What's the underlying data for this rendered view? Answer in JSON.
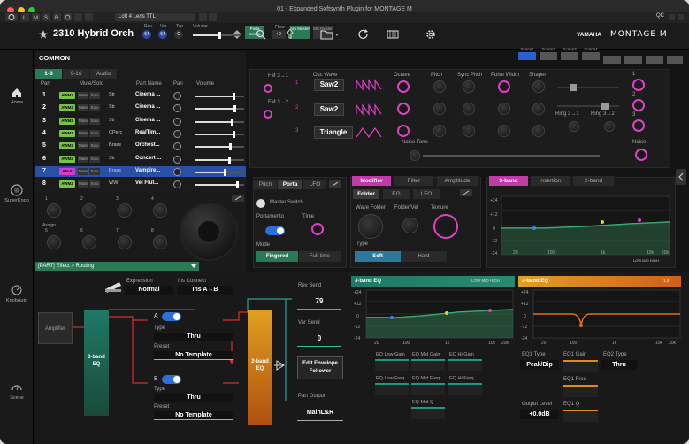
{
  "window": {
    "title": "01 - Expanded Softsynth Plugin for MONTAGE M"
  },
  "plugin_bar": {
    "preset": "Loft 4 Lens TTL",
    "qc": "QC"
  },
  "toolbar": {
    "perf_name": "2310 Hybrid Orch",
    "rev_label": "Rev",
    "rev_val": "64",
    "var_label": "Var",
    "var_val": "64",
    "tap_label": "Tap",
    "tap_val": "C",
    "volume_label": "Volume",
    "volume_level": 0.55,
    "portamento": "Porta mento",
    "flow_label": "Flow",
    "flow_val": "+0",
    "arp_master": "Arp Master",
    "ms_master": "MS Master",
    "brand": "YAMAHA",
    "model": "MONTAGE M"
  },
  "scenes": [
    "Scene1",
    "Scene2",
    "Scene3",
    "Scene4"
  ],
  "sidebar": [
    {
      "label": "Home",
      "icon": "home-icon"
    },
    {
      "label": "SuperKnob",
      "icon": "superknob-icon"
    },
    {
      "label": "KnobAuto",
      "icon": "knobauto-icon"
    },
    {
      "label": "Scene",
      "icon": "scene-icon"
    }
  ],
  "common": {
    "label": "COMMON",
    "tabs": [
      "1-8",
      "9-16",
      "Audio"
    ],
    "headers": {
      "part": "Part",
      "mute": "Mute/Solo",
      "partname": "Part Name",
      "pan": "Pan",
      "volume": "Volume"
    }
  },
  "parts": [
    {
      "num": "1",
      "type": "AWM2",
      "mute": "Mute",
      "solo": "Solo",
      "cat": "Str",
      "name": "Cinema ..."
    },
    {
      "num": "2",
      "type": "AWM2",
      "mute": "Mute",
      "solo": "Solo",
      "cat": "Str",
      "name": "Cinema ..."
    },
    {
      "num": "3",
      "type": "AWM2",
      "mute": "Mute",
      "solo": "Solo",
      "cat": "Str",
      "name": "Cinema ..."
    },
    {
      "num": "4",
      "type": "AWM2",
      "mute": "Mute",
      "solo": "Solo",
      "cat": "CPerc",
      "name": "RealTim..."
    },
    {
      "num": "5",
      "type": "AWM2",
      "mute": "Mute",
      "solo": "Solo",
      "cat": "Brass",
      "name": "Orchest..."
    },
    {
      "num": "6",
      "type": "AWM2",
      "mute": "Mute",
      "solo": "Solo",
      "cat": "Str",
      "name": "Concert ..."
    },
    {
      "num": "7",
      "type": "AN-X",
      "mute": "Mute",
      "solo": "Solo",
      "cat": "Brass",
      "name": "Vampire..."
    },
    {
      "num": "8",
      "type": "AWM2",
      "mute": "Mute",
      "solo": "Solo",
      "cat": "WW",
      "name": "Vel Flut..."
    }
  ],
  "part_volumes": [
    0.78,
    0.8,
    0.75,
    0.78,
    0.72,
    0.7,
    0.6,
    0.85
  ],
  "knobs": {
    "assign_label": "Assign",
    "numbers": [
      "1",
      "2",
      "3",
      "4",
      "5",
      "6",
      "7",
      "8"
    ]
  },
  "synth": {
    "fm1": "FM 3→1",
    "fm2": "FM 3→2",
    "osc_wave": "Osc Wave",
    "oscs": [
      "Saw2",
      "Saw2",
      "Triangle"
    ],
    "osc_nums": [
      "1",
      "2",
      "3"
    ],
    "cols": [
      "Octave",
      "Pitch",
      "Sync Pitch",
      "Pulse Width",
      "Shaper"
    ],
    "ring1": "Ring 3→1",
    "ring2": "Ring 3→2",
    "noise_tone": "Noise Tone",
    "noise": "Noise",
    "mixnums": [
      "1",
      "2",
      "3"
    ]
  },
  "pitch_panel": {
    "tabs": [
      "Pitch",
      "Porta",
      "LFO"
    ],
    "master_switch": "Master Switch",
    "portamento": "Portamento",
    "time": "Time",
    "mode": "Mode",
    "fingered": "Fingered",
    "fulltime": "Full-time"
  },
  "mod_panel": {
    "tabs": [
      "Modifier",
      "Filter",
      "Amplitude"
    ],
    "subtabs": [
      "Folder",
      "EG",
      "LFO"
    ],
    "wave_folder": "Wave Folder",
    "folder_vel": "Folder/Vel",
    "texture": "Texture",
    "type": "Type",
    "soft": "Soft",
    "hard": "Hard"
  },
  "eq_top": {
    "tabs": [
      "3-band",
      "Insertion",
      "2-band"
    ],
    "y": [
      "+24",
      "+12",
      "0",
      "-12",
      "-24"
    ],
    "x": [
      "20",
      "100",
      "1k",
      "10k",
      "20k"
    ],
    "bands": [
      "LOW",
      "MID",
      "HIGH"
    ]
  },
  "routing": {
    "title": "[PART] Effect > Routing",
    "expression": "Expression",
    "expression_val": "Normal",
    "ins_connect": "Ins Connect",
    "ins_val": "Ins A→B",
    "amplifier": "Amplifier",
    "eq3": "3-band EQ",
    "a": "A",
    "b": "B",
    "type": "Type",
    "type_val": "Thru",
    "preset": "Preset",
    "preset_val": "No Template",
    "eq2": "2-band EQ",
    "rev_send": "Rev Send",
    "rev_val": "79",
    "var_send": "Var Send",
    "var_val": "0",
    "edit_env": "Edit Envelope Follower",
    "part_output": "Part Output",
    "part_out_val": "MainL&R"
  },
  "eq3": {
    "title": "3-band EQ",
    "y": [
      "+24",
      "+12",
      "0",
      "-12",
      "-24"
    ],
    "x": [
      "20",
      "100",
      "1k",
      "10k",
      "20k"
    ],
    "bands": [
      "LOW",
      "MID",
      "HIGH"
    ],
    "params": [
      "EQ Low Gain",
      "EQ Mid Gain",
      "EQ Hi Gain",
      "EQ Low Freq",
      "EQ Mid Freq",
      "EQ Hi Freq",
      "EQ Mid Q"
    ]
  },
  "eq2": {
    "title": "2-band EQ",
    "y": [
      "+24",
      "+12",
      "0",
      "-12",
      "-24"
    ],
    "x": [
      "20",
      "100",
      "1k",
      "10k",
      "20k"
    ],
    "bands": [
      "1",
      "2"
    ],
    "eq1type": "EQ1 Type",
    "eq1type_val": "Peak/Dip",
    "eq1gain": "EQ1 Gain",
    "eq2type": "EQ2 Type",
    "eq2type_val": "Thru",
    "eq1freq": "EQ1 Freq",
    "output_level": "Output Level",
    "output_val": "+0.0dB",
    "eq1q": "EQ1 Q"
  },
  "colors": {
    "accent_pink": "#e040c8",
    "accent_blue": "#2d6fd9",
    "awm_green": "#76c442",
    "anx_pink": "#d23cc8",
    "eq_green": "#2d6b48",
    "eq_orange": "#e08a1a"
  }
}
